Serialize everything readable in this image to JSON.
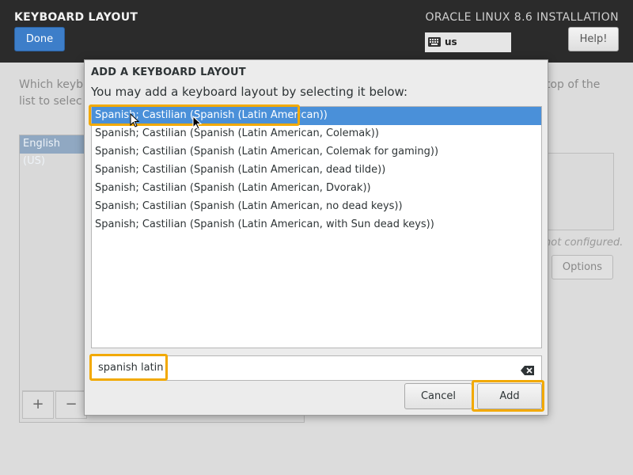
{
  "header": {
    "spoke_title": "KEYBOARD LAYOUT",
    "done_label": "Done",
    "product_title": "ORACLE LINUX 8.6 INSTALLATION",
    "keyboard_indicator": "us",
    "help_label": "Help!"
  },
  "background": {
    "description_line1_start": "Which keyb",
    "description_line2_start": "list to selec",
    "description_line1_end": "top of the",
    "selected_layout": "English (US)",
    "add_symbol": "+",
    "remove_symbol": "−",
    "not_configured": "not configured.",
    "options_label": "Options"
  },
  "dialog": {
    "title": "ADD A KEYBOARD LAYOUT",
    "subtitle": "You may add a keyboard layout by selecting it below:",
    "layouts": [
      "Spanish; Castilian (Spanish (Latin American))",
      "Spanish; Castilian (Spanish (Latin American, Colemak))",
      "Spanish; Castilian (Spanish (Latin American, Colemak for gaming))",
      "Spanish; Castilian (Spanish (Latin American, dead tilde))",
      "Spanish; Castilian (Spanish (Latin American, Dvorak))",
      "Spanish; Castilian (Spanish (Latin American, no dead keys))",
      "Spanish; Castilian (Spanish (Latin American, with Sun dead keys))"
    ],
    "selected_index": 0,
    "search_value": "spanish latin",
    "cancel_label": "Cancel",
    "add_label": "Add"
  },
  "colors": {
    "header_bg": "#2b2b2b",
    "accent_blue": "#3d7ec9",
    "selection_blue": "#4a90d9",
    "highlight_orange": "#f2a900"
  },
  "icons": {
    "keyboard": "keyboard-icon",
    "clear": "clear-text-icon",
    "cursor": "mouse-pointer-icon"
  }
}
